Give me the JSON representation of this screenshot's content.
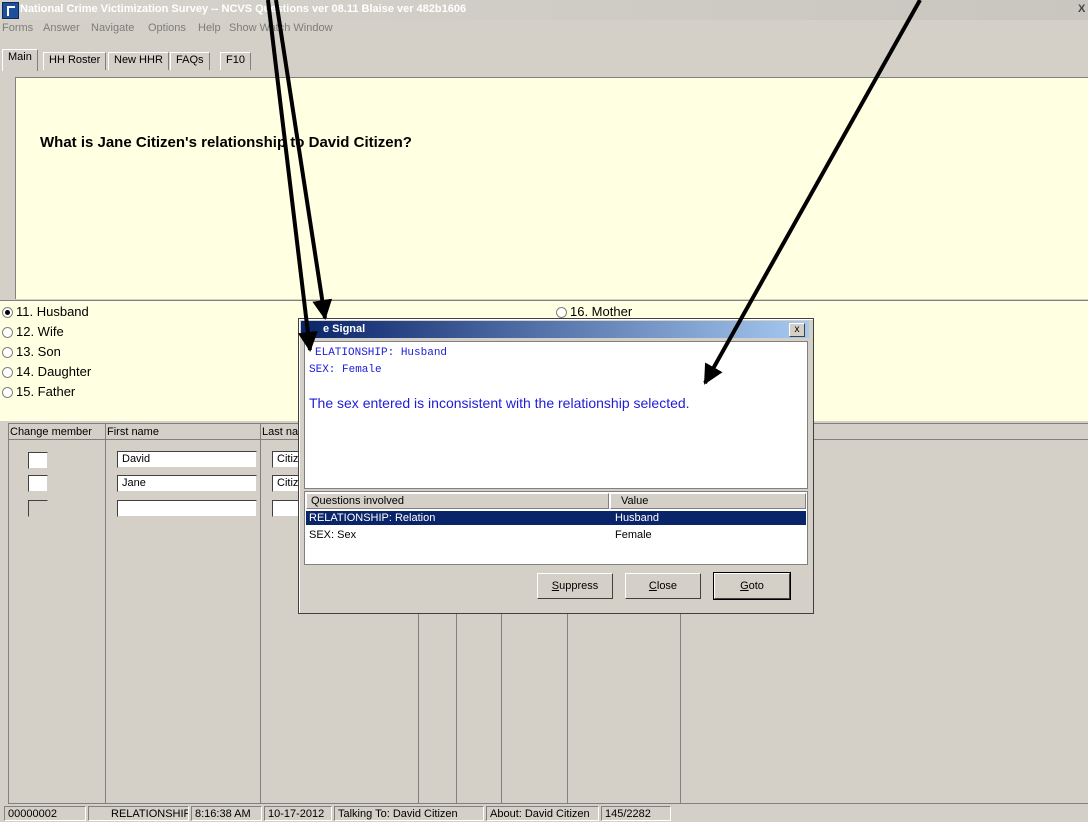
{
  "window": {
    "title": "National Crime Victimization Survey -- NCVS Questions ver 08.11 Blaise ver 482b1606",
    "close_glyph": "X"
  },
  "menu": [
    "Forms",
    "Answer",
    "Navigate",
    "Options",
    "Help",
    "Show Watch Window"
  ],
  "tabs": [
    "Main",
    "HH Roster",
    "New HHR",
    "FAQs",
    "F10"
  ],
  "question": {
    "text": "What is Jane Citizen's relationship to David Citizen?"
  },
  "answers": {
    "options": [
      {
        "label": "11. Husband",
        "selected": true
      },
      {
        "label": "12. Wife",
        "selected": false
      },
      {
        "label": "13. Son",
        "selected": false
      },
      {
        "label": "14. Daughter",
        "selected": false
      },
      {
        "label": "15. Father",
        "selected": false
      },
      {
        "label": "16. Mother",
        "selected": false
      }
    ]
  },
  "roster": {
    "headers": {
      "change_member": "Change member",
      "first_name": "First name",
      "last_name": "Last na"
    },
    "rows": [
      {
        "first": "David",
        "last": "Citize"
      },
      {
        "first": "Jane",
        "last": "Citize"
      },
      {
        "first": "",
        "last": ""
      }
    ]
  },
  "dialog": {
    "title": "Hard Signal",
    "title_visible": "e Signal",
    "close_glyph": "x",
    "line1": "RELATIONSHIP: Husband",
    "line1_visible": "ELATIONSHIP: Husband",
    "line2": "SEX: Female",
    "message": "The sex entered is inconsistent with the relationship selected.",
    "grid": {
      "headers": [
        "Questions involved",
        "Value"
      ],
      "rows": [
        {
          "question": "RELATIONSHIP: Relation",
          "value": "Husband",
          "selected": true
        },
        {
          "question": "SEX: Sex",
          "value": "Female",
          "selected": false
        }
      ]
    },
    "buttons": {
      "suppress": "Suppress",
      "close": "Close",
      "goto": "Goto"
    }
  },
  "status": {
    "case_id": "00000002",
    "field": "RELATIONSHIP",
    "time": "8:16:38 AM",
    "date": "10-17-2012",
    "talking_to": "Talking To: David Citizen",
    "about": "About: David Citizen",
    "counter": "145/2282"
  },
  "colors": {
    "question_bg": "#ffffe1",
    "dialog_text": "#1d1dd6",
    "selection": "#0a246a"
  }
}
